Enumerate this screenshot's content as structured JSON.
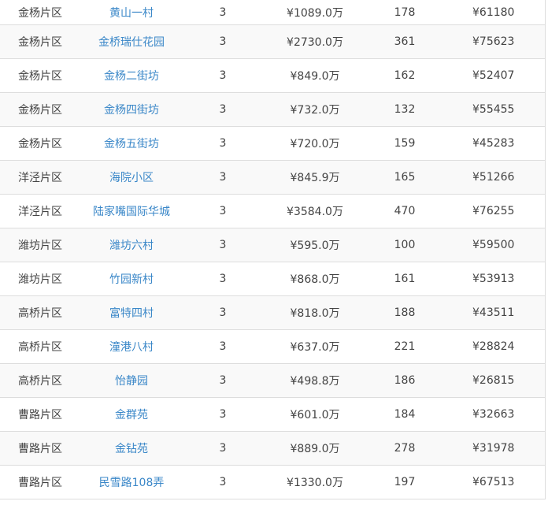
{
  "table": {
    "rows": [
      {
        "district": "金杨片区",
        "community": "黄山一村",
        "rooms": "3",
        "price": "¥1089.0万",
        "area": "178",
        "unit_price": "¥61180"
      },
      {
        "district": "金杨片区",
        "community": "金桥瑞仕花园",
        "rooms": "3",
        "price": "¥2730.0万",
        "area": "361",
        "unit_price": "¥75623"
      },
      {
        "district": "金杨片区",
        "community": "金杨二街坊",
        "rooms": "3",
        "price": "¥849.0万",
        "area": "162",
        "unit_price": "¥52407"
      },
      {
        "district": "金杨片区",
        "community": "金杨四街坊",
        "rooms": "3",
        "price": "¥732.0万",
        "area": "132",
        "unit_price": "¥55455"
      },
      {
        "district": "金杨片区",
        "community": "金杨五街坊",
        "rooms": "3",
        "price": "¥720.0万",
        "area": "159",
        "unit_price": "¥45283"
      },
      {
        "district": "洋泾片区",
        "community": "海院小区",
        "rooms": "3",
        "price": "¥845.9万",
        "area": "165",
        "unit_price": "¥51266"
      },
      {
        "district": "洋泾片区",
        "community": "陆家嘴国际华城",
        "rooms": "3",
        "price": "¥3584.0万",
        "area": "470",
        "unit_price": "¥76255"
      },
      {
        "district": "潍坊片区",
        "community": "潍坊六村",
        "rooms": "3",
        "price": "¥595.0万",
        "area": "100",
        "unit_price": "¥59500"
      },
      {
        "district": "潍坊片区",
        "community": "竹园新村",
        "rooms": "3",
        "price": "¥868.0万",
        "area": "161",
        "unit_price": "¥53913"
      },
      {
        "district": "高桥片区",
        "community": "富特四村",
        "rooms": "3",
        "price": "¥818.0万",
        "area": "188",
        "unit_price": "¥43511"
      },
      {
        "district": "高桥片区",
        "community": "潼港八村",
        "rooms": "3",
        "price": "¥637.0万",
        "area": "221",
        "unit_price": "¥28824"
      },
      {
        "district": "高桥片区",
        "community": "怡静园",
        "rooms": "3",
        "price": "¥498.8万",
        "area": "186",
        "unit_price": "¥26815"
      },
      {
        "district": "曹路片区",
        "community": "金群苑",
        "rooms": "3",
        "price": "¥601.0万",
        "area": "184",
        "unit_price": "¥32663"
      },
      {
        "district": "曹路片区",
        "community": "金钻苑",
        "rooms": "3",
        "price": "¥889.0万",
        "area": "278",
        "unit_price": "¥31978"
      },
      {
        "district": "曹路片区",
        "community": "民雪路108弄",
        "rooms": "3",
        "price": "¥1330.0万",
        "area": "197",
        "unit_price": "¥67513"
      }
    ]
  },
  "colors": {
    "link": "#3a87c8",
    "text": "#444444",
    "border": "#dddddd",
    "stripe": "#f9f9f9"
  }
}
